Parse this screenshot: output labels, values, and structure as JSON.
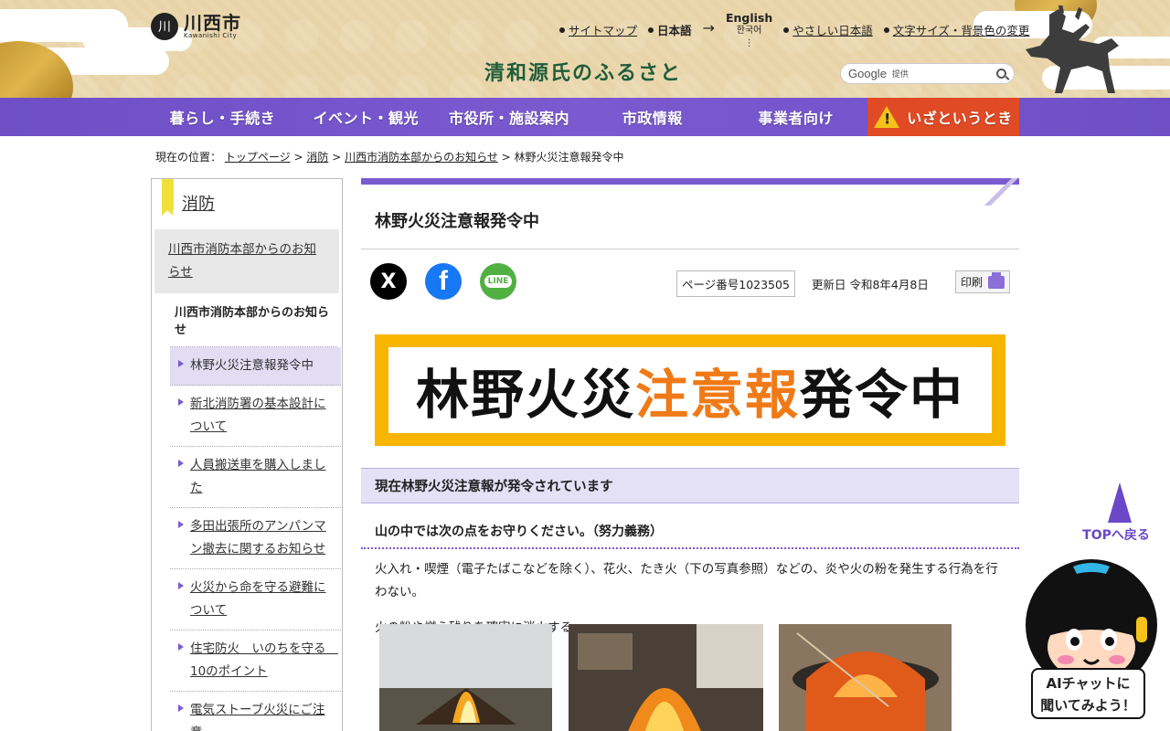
{
  "header": {
    "logo_mark": "川",
    "logo_name": "川西市",
    "logo_sub": "Kawanishi City",
    "utility": {
      "sitemap": "サイトマップ",
      "japanese": "日本語",
      "arrow": "→",
      "english": "English",
      "korean": "한국어",
      "more": "⋮",
      "easy_japanese": "やさしい日本語",
      "text_size": "文字サイズ・背景色の変更"
    },
    "tagline": "清和源氏のふるさと",
    "search": {
      "brand": "Google",
      "provided": "提供"
    }
  },
  "nav": {
    "items": [
      "暮らし・手続き",
      "イベント・観光",
      "市役所・施設案内",
      "市政情報",
      "事業者向け"
    ],
    "emergency": "いざというとき"
  },
  "breadcrumb": {
    "prefix": "現在の位置：",
    "links": [
      "トップページ",
      "消防",
      "川西市消防本部からのお知らせ"
    ],
    "separator": ">",
    "current": "林野火災注意報発令中"
  },
  "sidebar": {
    "heading": "消防",
    "section": "川西市消防本部からのお知らせ",
    "sub_heading": "川西市消防本部からのお知らせ",
    "items": [
      "林野火災注意報発令中",
      "新北消防署の基本設計について",
      "人員搬送車を購入しました",
      "多田出張所のアンパンマン撤去に関するお知らせ",
      "火災から命を守る避難について",
      "住宅防火　いのちを守る　10のポイント",
      "電気ストーブ火災にご注意"
    ]
  },
  "main": {
    "title": "林野火災注意報発令中",
    "sns": {
      "x": "X",
      "facebook": "f",
      "line": "LINE"
    },
    "page_number": "ページ番号1023505",
    "updated": "更新日 令和8年4月8日",
    "print": "印刷",
    "banner": {
      "part1": "林野火災",
      "part2": "注意報",
      "part3": "発令中"
    },
    "h2": "現在林野火災注意報が発令されています",
    "h3": "山の中では次の点をお守りください。（努力義務）",
    "para1": "火入れ・喫煙（電子たばこなどを除く）、花火、たき火（下の写真参照）などの、炎や火の粉を発生する行為を行わない。",
    "para2": "火の粉や燃え残りを確実に消火する。"
  },
  "floaters": {
    "totop": "TOPへ戻る",
    "ai_line1": "AIチャットに",
    "ai_line2": "聞いてみよう！"
  },
  "colors": {
    "nav": "#7b5ad0",
    "emergency": "#e04a24",
    "banner_frame": "#f7b500",
    "banner_accent": "#f07a17",
    "tagline": "#1f5d3a"
  }
}
